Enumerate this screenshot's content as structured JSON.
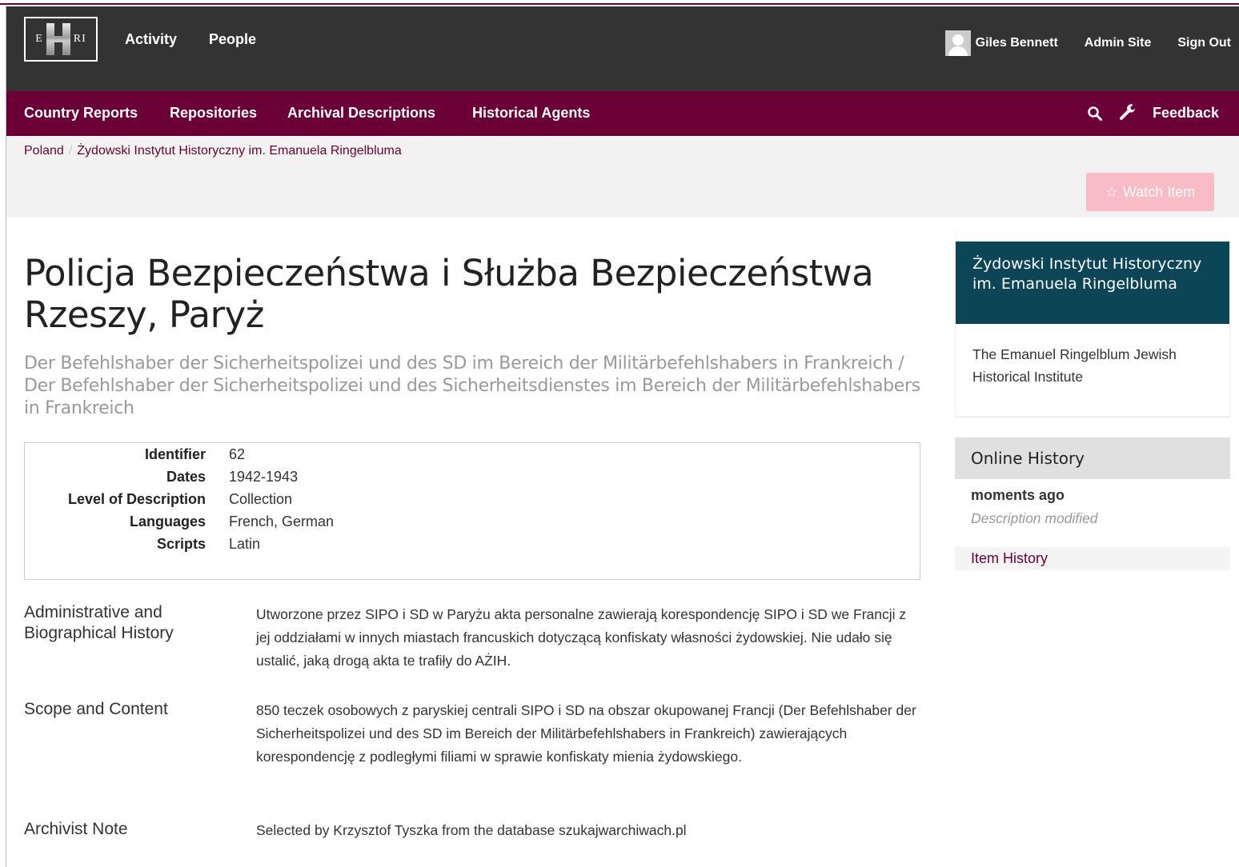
{
  "topbar": {
    "logo_left": "E",
    "logo_right": "RI",
    "links": [
      "Activity",
      "People"
    ],
    "user_name": "Giles Bennett",
    "admin_link": "Admin Site",
    "signout_link": "Sign Out"
  },
  "subnav": {
    "links": [
      "Country Reports",
      "Repositories",
      "Archival Descriptions",
      "Historical Agents"
    ],
    "feedback": "Feedback"
  },
  "breadcrumb": {
    "items": [
      "Poland",
      "Żydowski Instytut Historyczny im. Emanuela Ringelbluma"
    ],
    "separator": "/"
  },
  "watch_button": {
    "icon": "star-icon",
    "star_glyph": "☆",
    "label": "Watch Item"
  },
  "record": {
    "title": "Policja Bezpieczeństwa i Służba Bezpieczeństwa Rzeszy, Paryż",
    "subtitle": "Der Befehlshaber der Sicherheitspolizei und des SD im Bereich der Militärbefehlshabers in Frankreich / Der Befehlshaber der Sicherheitspolizei und des Sicherheitsdienstes im Bereich der Militärbefehlshabers in Frankreich",
    "details": [
      {
        "label": "Identifier",
        "value": "62"
      },
      {
        "label": "Dates",
        "value": "1942-1943"
      },
      {
        "label": "Level of Description",
        "value": "Collection"
      },
      {
        "label": "Languages",
        "value": "French, German"
      },
      {
        "label": "Scripts",
        "value": "Latin"
      }
    ],
    "fields": [
      {
        "label": "Administrative and Biographical History",
        "value": "Utworzone przez SIPO i SD w Paryżu akta personalne zawierają korespondencję SIPO i SD we Francji z jej oddziałami w innych miastach francuskich dotyczącą konfiskaty własności żydowskiej. Nie udało się ustalić, jaką drogą akta te trafiły do AŻIH."
      },
      {
        "label": "Scope and Content",
        "value": "850 teczek osobowych z paryskiej centrali SIPO i SD na obszar okupowanej Francji (Der Befehlshaber der Sicherheitspolizei und des SD im Bereich der Militärbefehlshabers in Frankreich) zawierających korespondencję z podległymi filiami w sprawie konfiskaty mienia żydowskiego."
      },
      {
        "label": "Archivist Note",
        "value": "Selected by Krzysztof Tyszka from the database szukajwarchiwach.pl"
      }
    ]
  },
  "sidebar": {
    "institution_name": "Żydowski Instytut Historyczny im. Emanuela Ringelbluma",
    "institution_other_name": "The Emanuel Ringelblum Jewish Historical Institute",
    "history_heading": "Online History",
    "history_when": "moments ago",
    "history_what": "Description modified",
    "history_link": "Item History"
  },
  "colors": {
    "topbar": "#333333",
    "subnav": "#6a0035",
    "institution_header": "#0b4556",
    "watch_button": "#f7bcc6",
    "link": "#6a0035"
  }
}
